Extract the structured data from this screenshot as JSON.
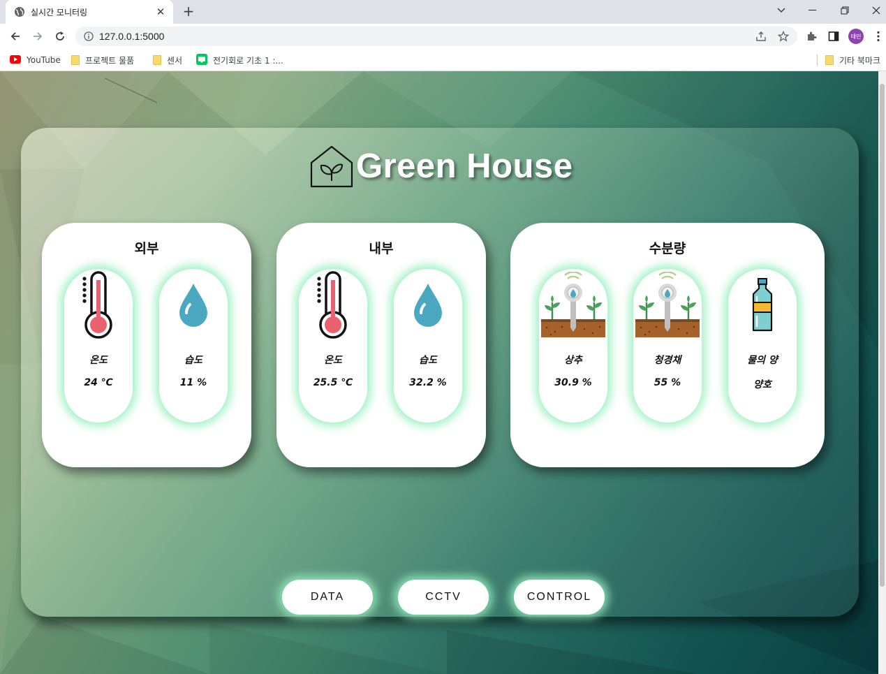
{
  "browser": {
    "tab_title": "실시간 모니터링",
    "url": "127.0.0.1:5000",
    "profile_initials": "태민",
    "bookmarks": [
      "YouTube",
      "프로젝트 물품",
      "센서",
      "전기회로 기초 1 :..."
    ],
    "other_bookmarks": "기타 북마크"
  },
  "page": {
    "title": "Green House",
    "cards": [
      {
        "title": "외부",
        "items": [
          {
            "label": "온도",
            "value": "24 ℃",
            "icon": "thermometer-icon"
          },
          {
            "label": "습도",
            "value": "11 %",
            "icon": "water-drop-icon"
          }
        ]
      },
      {
        "title": "내부",
        "items": [
          {
            "label": "온도",
            "value": "25.5 ℃",
            "icon": "thermometer-icon"
          },
          {
            "label": "습도",
            "value": "32.2 %",
            "icon": "water-drop-icon"
          }
        ]
      },
      {
        "title": "수분량",
        "items": [
          {
            "label": "상추",
            "value": "30.9 %",
            "icon": "soil-sensor-icon"
          },
          {
            "label": "청경채",
            "value": "55 %",
            "icon": "soil-sensor-icon"
          },
          {
            "label": "물의 양",
            "value": "양호",
            "icon": "water-bottle-icon"
          }
        ]
      }
    ],
    "buttons": [
      "DATA",
      "CCTV",
      "CONTROL"
    ]
  },
  "colors": {
    "glow": "#96f0be",
    "thermo_red": "#e8636f",
    "drop_blue": "#4aa8c0"
  }
}
